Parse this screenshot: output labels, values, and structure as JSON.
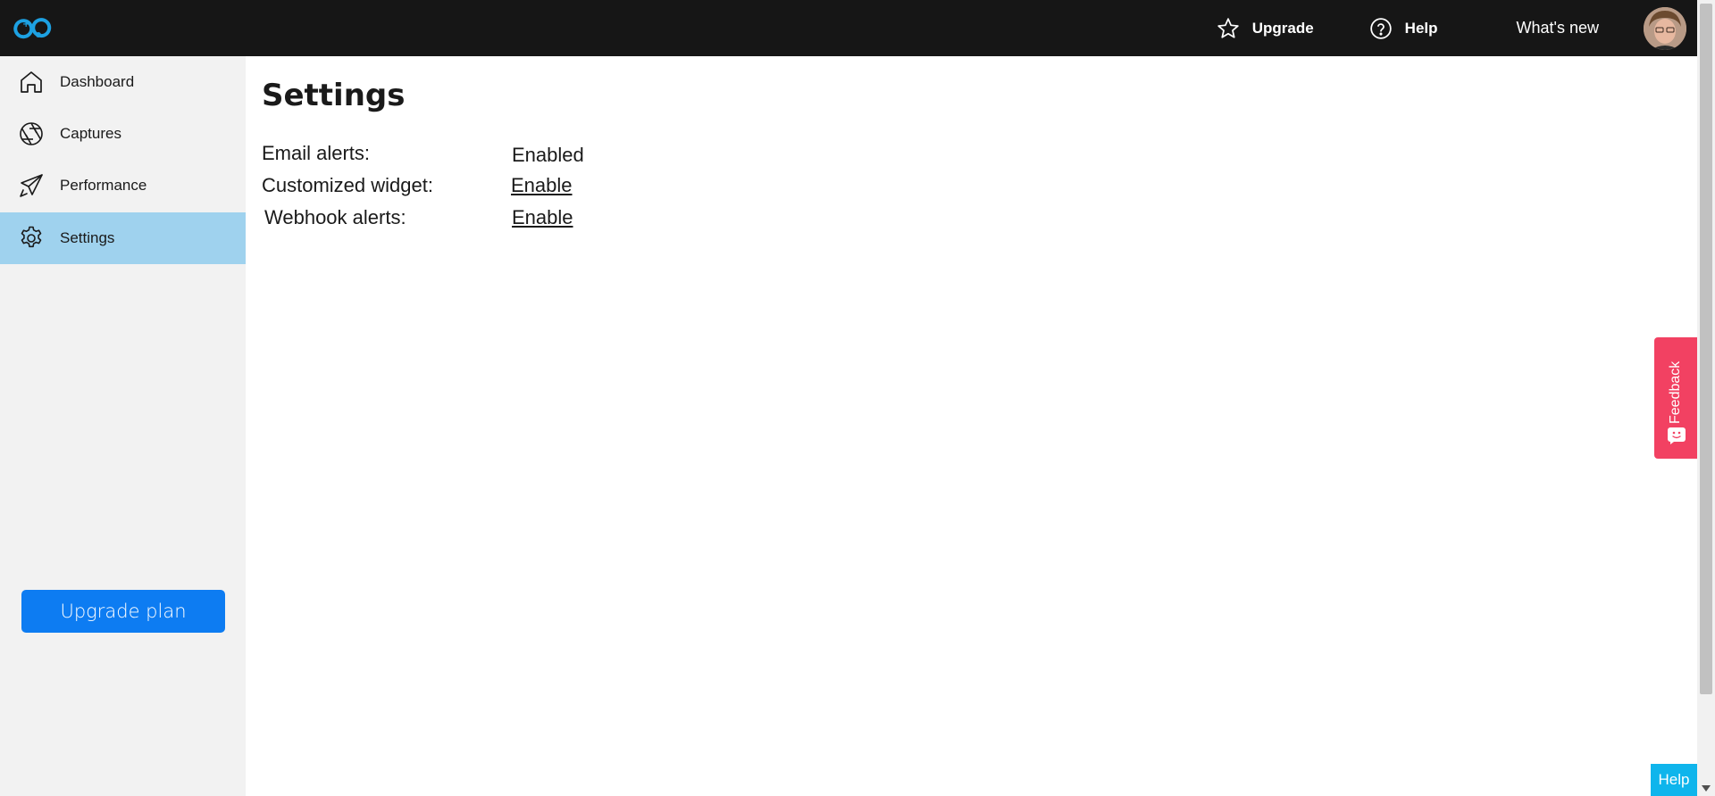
{
  "header": {
    "logo_icon": "app-logo-icon",
    "upgrade_label": "Upgrade",
    "help_label": "Help",
    "whats_new_label": "What's new",
    "background_color": "#161616"
  },
  "sidebar": {
    "items": [
      {
        "label": "Dashboard",
        "icon": "home-icon",
        "active": false
      },
      {
        "label": "Captures",
        "icon": "aperture-icon",
        "active": false
      },
      {
        "label": "Performance",
        "icon": "rocket-icon",
        "active": false
      },
      {
        "label": "Settings",
        "icon": "gear-icon",
        "active": true
      }
    ],
    "upgrade_plan_label": "Upgrade plan",
    "active_color": "#9fd2ee",
    "upgrade_button_color": "#0d7cf2"
  },
  "main": {
    "title": "Settings",
    "settings": [
      {
        "label": "Email alerts:",
        "value": "Enabled",
        "is_link": false
      },
      {
        "label": "Customized widget:",
        "value": "Enable",
        "is_link": true
      },
      {
        "label": "Webhook alerts:",
        "value": "Enable",
        "is_link": true
      }
    ]
  },
  "feedback": {
    "label": "Feedback",
    "color": "#f24162"
  },
  "help_widget": {
    "label": "Help",
    "color": "#0fb5ec"
  }
}
